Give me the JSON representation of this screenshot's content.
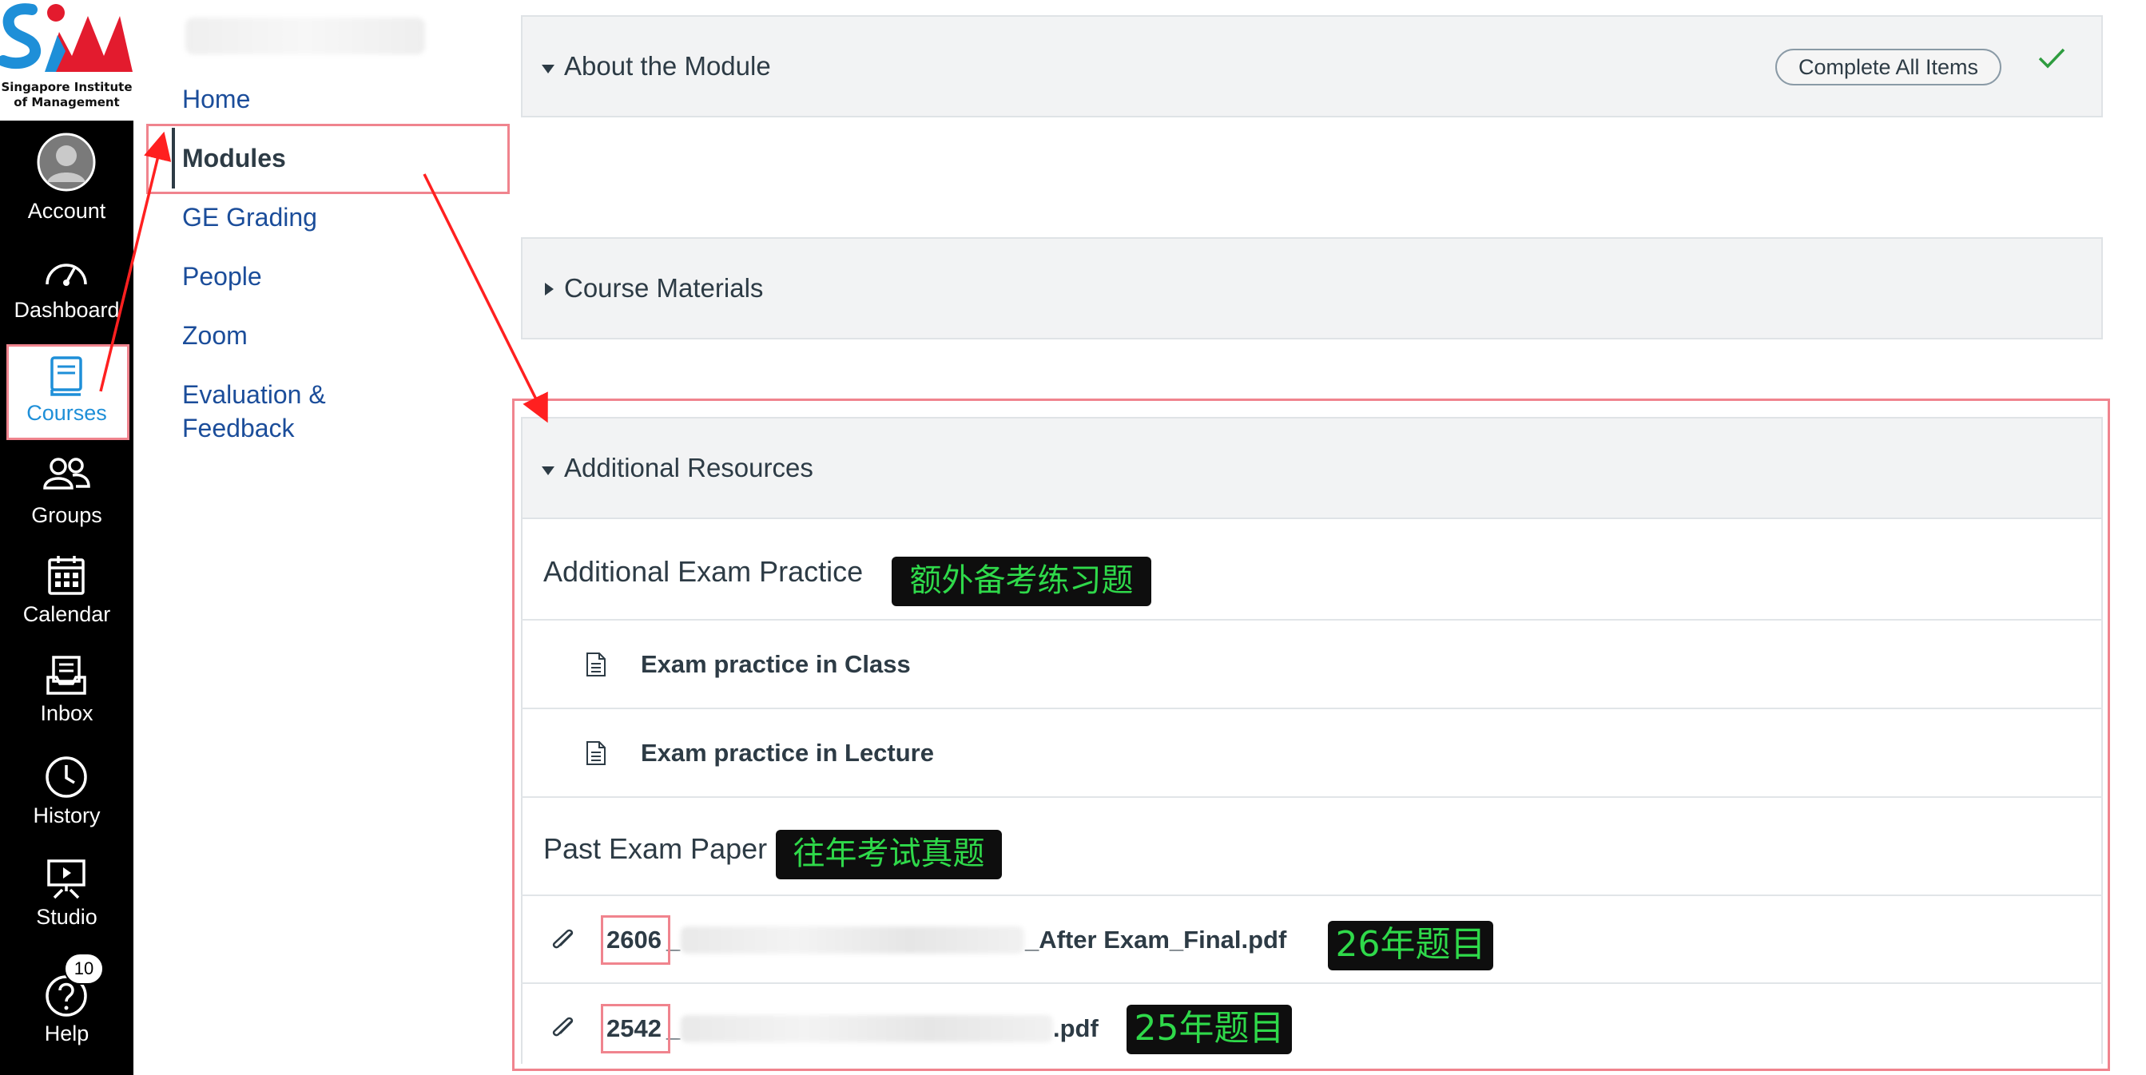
{
  "logo": {
    "letters": "SIM",
    "line1": "Singapore Institute",
    "line2": "of Management"
  },
  "global_nav": {
    "items": [
      {
        "label": "Account",
        "icon": "avatar-icon"
      },
      {
        "label": "Dashboard",
        "icon": "dashboard-gauge-icon"
      },
      {
        "label": "Courses",
        "icon": "book-icon",
        "active": true
      },
      {
        "label": "Groups",
        "icon": "groups-icon"
      },
      {
        "label": "Calendar",
        "icon": "calendar-icon"
      },
      {
        "label": "Inbox",
        "icon": "inbox-icon"
      },
      {
        "label": "History",
        "icon": "clock-icon"
      },
      {
        "label": "Studio",
        "icon": "studio-icon"
      },
      {
        "label": "Help",
        "icon": "help-icon",
        "badge": "10"
      }
    ]
  },
  "course_nav": {
    "items": [
      {
        "label": "Home"
      },
      {
        "label": "Modules",
        "active": true
      },
      {
        "label": "GE Grading"
      },
      {
        "label": "People"
      },
      {
        "label": "Zoom"
      },
      {
        "label": "Evaluation &",
        "label2": "Feedback"
      }
    ]
  },
  "modules": {
    "about": {
      "title": "About the Module",
      "complete_all_label": "Complete All Items"
    },
    "materials": {
      "title": "Course Materials"
    },
    "resources": {
      "title": "Additional Resources",
      "exam_practice_header": "Additional Exam Practice",
      "exam_practice_tag": "额外备考练习题",
      "items": [
        {
          "title": "Exam practice in Class",
          "icon": "page-icon"
        },
        {
          "title": "Exam practice in Lecture",
          "icon": "page-icon"
        }
      ],
      "past_paper_header": "Past Exam Paper",
      "past_paper_tag": "往年考试真题",
      "files": [
        {
          "prefix": "2606",
          "sep": "_",
          "suffix": "_After Exam_Final.pdf",
          "tag": "26年题目",
          "icon": "paperclip-icon"
        },
        {
          "prefix": "2542",
          "sep": "_",
          "suffix": ".pdf",
          "tag": "25年题目",
          "icon": "paperclip-icon"
        }
      ]
    }
  },
  "colors": {
    "nav_bg": "#000000",
    "active_blue": "#1e8fd8",
    "annotation_red": "#f0848e",
    "arrow_red": "#ff2020",
    "tag_green": "#2fd94a",
    "check_green": "#2e9c3f"
  }
}
